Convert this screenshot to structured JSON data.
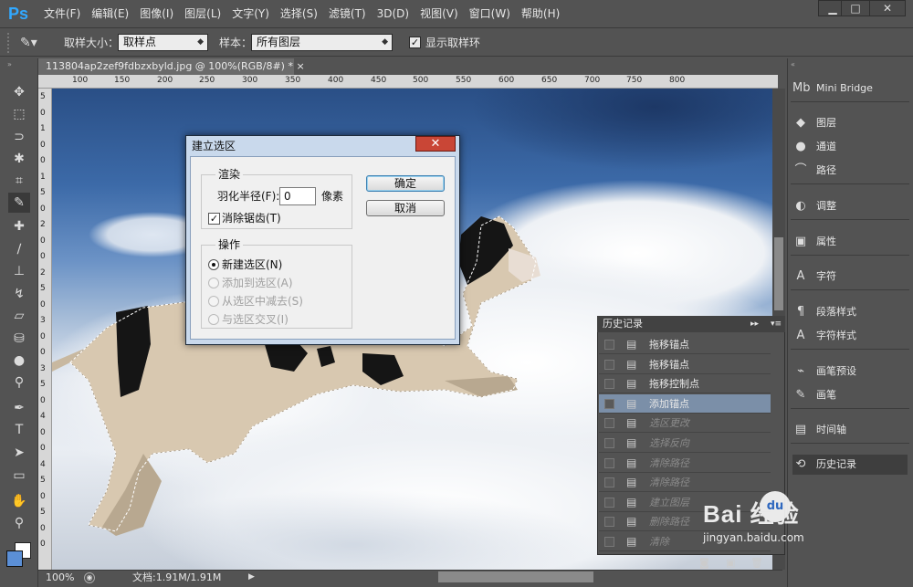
{
  "app": {
    "logo": "Ps"
  },
  "menu": [
    "文件(F)",
    "编辑(E)",
    "图像(I)",
    "图层(L)",
    "文字(Y)",
    "选择(S)",
    "滤镜(T)",
    "3D(D)",
    "视图(V)",
    "窗口(W)",
    "帮助(H)"
  ],
  "window_buttons": {
    "minimize": "▁",
    "maximize": "□",
    "close": "✕"
  },
  "options": {
    "sample_size_label": "取样大小：",
    "sample_size_value": "取样点",
    "sample_label": "样本：",
    "sample_value": "所有图层",
    "show_ring_label": "显示取样环",
    "show_ring_checked": "✓"
  },
  "document": {
    "tab_title": "113804ap2zef9fdbzxbyld.jpg @ 100%(RGB/8#) *",
    "tab_close": "×",
    "ruler_top": [
      "100",
      "150",
      "200",
      "250",
      "300",
      "350",
      "400",
      "450",
      "500",
      "550",
      "600",
      "650",
      "700",
      "750",
      "800"
    ],
    "ruler_left": [
      "5",
      "0",
      "1",
      "0",
      "0",
      "1",
      "5",
      "0",
      "2",
      "0",
      "0",
      "2",
      "5",
      "0",
      "3",
      "0",
      "0",
      "3",
      "5",
      "0",
      "4",
      "0",
      "0",
      "4",
      "5",
      "0",
      "5",
      "0",
      "0"
    ]
  },
  "status": {
    "zoom": "100%",
    "doc_info": "文档:1.91M/1.91M"
  },
  "right_panels": [
    {
      "icon": "mini-bridge-icon",
      "glyph": "Mb",
      "label": "Mini Bridge"
    },
    {
      "icon": "layers-icon",
      "glyph": "◆",
      "label": "图层"
    },
    {
      "icon": "channels-icon",
      "glyph": "●",
      "label": "通道"
    },
    {
      "icon": "paths-icon",
      "glyph": "⌒",
      "label": "路径"
    },
    {
      "icon": "adjustments-icon",
      "glyph": "◐",
      "label": "调整"
    },
    {
      "icon": "properties-icon",
      "glyph": "▣",
      "label": "属性"
    },
    {
      "icon": "character-icon",
      "glyph": "A",
      "label": "字符"
    },
    {
      "icon": "paragraph-styles-icon",
      "glyph": "¶",
      "label": "段落样式"
    },
    {
      "icon": "character-styles-icon",
      "glyph": "A",
      "label": "字符样式"
    },
    {
      "icon": "brush-presets-icon",
      "glyph": "⌁",
      "label": "画笔预设"
    },
    {
      "icon": "brush-icon",
      "glyph": "✎",
      "label": "画笔"
    },
    {
      "icon": "timeline-icon",
      "glyph": "▤",
      "label": "时间轴"
    },
    {
      "icon": "history-icon",
      "glyph": "⟲",
      "label": "历史记录"
    }
  ],
  "history": {
    "title": "历史记录",
    "items": [
      {
        "label": "拖移锚点",
        "state": "normal"
      },
      {
        "label": "拖移锚点",
        "state": "normal"
      },
      {
        "label": "拖移控制点",
        "state": "normal"
      },
      {
        "label": "添加锚点",
        "state": "selected"
      },
      {
        "label": "选区更改",
        "state": "dim"
      },
      {
        "label": "选择反向",
        "state": "dim"
      },
      {
        "label": "清除路径",
        "state": "dim"
      },
      {
        "label": "清除路径",
        "state": "dim"
      },
      {
        "label": "建立图层",
        "state": "dim"
      },
      {
        "label": "删除路径",
        "state": "dim"
      },
      {
        "label": "清除",
        "state": "dim"
      }
    ]
  },
  "dialog": {
    "title": "建立选区",
    "close": "✕",
    "render_group": "渲染",
    "feather_label": "羽化半径(F):",
    "feather_value": "0",
    "feather_unit": "像素",
    "antialias_label": "消除锯齿(T)",
    "antialias_checked": "✓",
    "operation_group": "操作",
    "operations": [
      "新建选区(N)",
      "添加到选区(A)",
      "从选区中减去(S)",
      "与选区交叉(I)"
    ],
    "ok": "确定",
    "cancel": "取消"
  },
  "watermark": {
    "brand": "Bai  经验",
    "paw": "du",
    "url": "jingyan.baidu.com"
  }
}
